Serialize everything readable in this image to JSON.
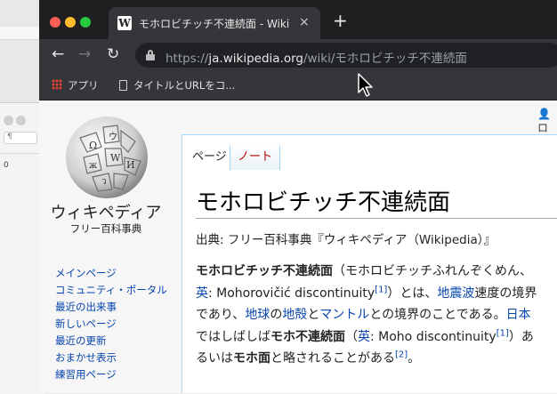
{
  "browser": {
    "tab_title": "モホロビチッチ不連続面 - Wikipedia",
    "tab_favicon_letter": "W",
    "tab_close": "×",
    "new_tab": "+",
    "url_scheme": "https://",
    "url_host": "ja.wikipedia.org",
    "url_path": "/wiki/モホロビチッチ不連続面",
    "nav": {
      "back": "←",
      "forward": "→",
      "reload": "↻"
    },
    "bookmarks": [
      {
        "label": "アプリ",
        "icon": "apps-grid-icon"
      },
      {
        "label": "タイトルとURLをコ...",
        "icon": "page-icon"
      }
    ]
  },
  "page": {
    "user_icon": "👤 ロ",
    "logo_text": "ウィキペディア",
    "logo_subtext": "フリー百科事典",
    "tabs": [
      "ページ",
      "ノート"
    ],
    "sidebar": [
      "メインページ",
      "コミュニティ・ポータル",
      "最近の出来事",
      "新しいページ",
      "最近の更新",
      "おまかせ表示",
      "練習用ページ"
    ],
    "title": "モホロビチッチ不連続面",
    "from_line": "出典: フリー百科事典『ウィキペディア（Wikipedia）』",
    "body": {
      "bold1": "モホロビチッチ不連続面",
      "t1": "（モホロビチッチふれんぞくめん、",
      "l_en1": "英",
      "t2": ": Mohorovičić discontinuity",
      "ref1": "[1]",
      "t3": "）とは、",
      "l_quake": "地震波",
      "t4": "速度の境界であり、",
      "l_earth": "地球",
      "t5": "の",
      "l_crust": "地殻",
      "t6": "と",
      "l_mantle": "マントル",
      "t7": "との境界のことである。",
      "l_japan": "日本",
      "t8": "ではしばしば",
      "bold2": "モホ不連続面",
      "t9": "（",
      "l_en2": "英",
      "t10": ": Moho discontinuity",
      "ref2": "[1]",
      "t11": "）あるいは",
      "bold3": "モホ面",
      "t12": "と略されることがある",
      "ref3": "[2]",
      "t13": "。"
    }
  },
  "background_app": {
    "style_label": "¶",
    "ruler_label": "0"
  },
  "colors": {
    "link": "#0645ad",
    "chrome_dark": "#35363a",
    "titlebar": "#1f1f21"
  }
}
